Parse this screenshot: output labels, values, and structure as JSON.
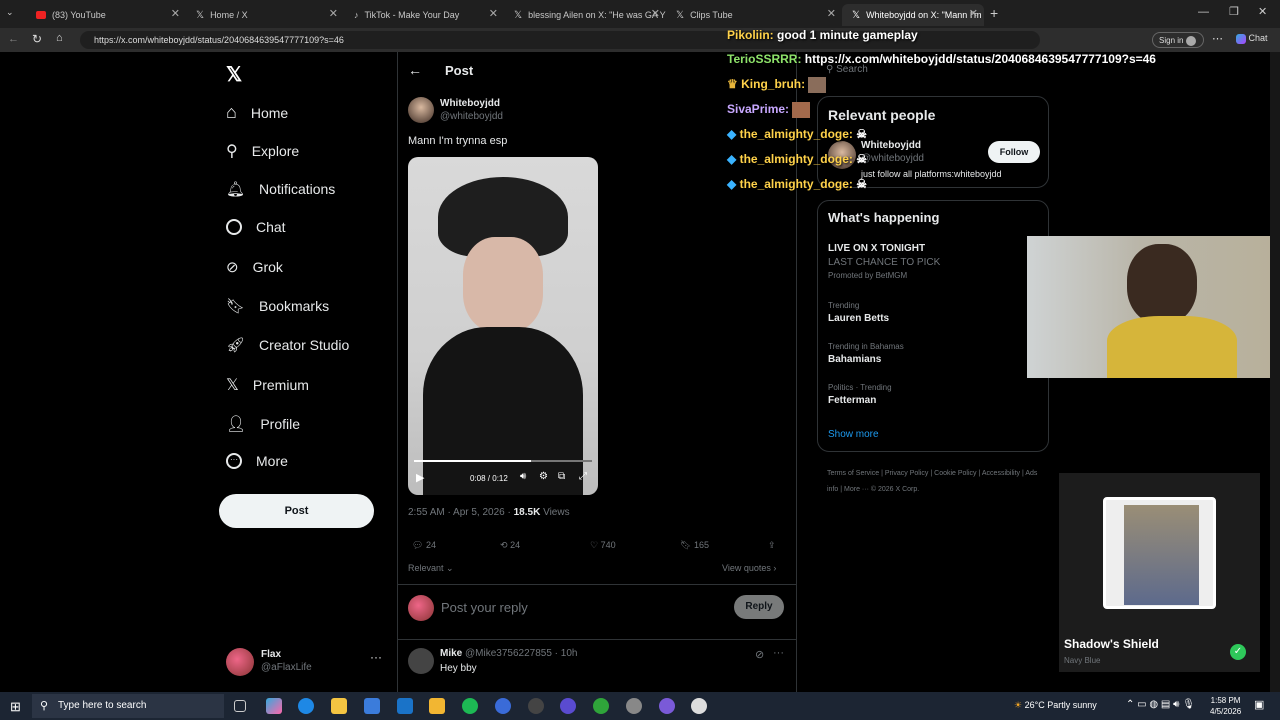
{
  "browser": {
    "tabs": [
      {
        "label": "(83) YouTube"
      },
      {
        "label": "Home / X"
      },
      {
        "label": "TikTok - Make Your Day"
      },
      {
        "label": "blessing Ailen on X: \"He was GA Y"
      },
      {
        "label": "Clips Tube"
      },
      {
        "label": "Whiteboyjdd on X: \"Mann I'm"
      }
    ],
    "url": "https://x.com/whiteboyjdd/status/2040684639547777109?s=46",
    "sign_in": "Sign in",
    "chat": "Chat"
  },
  "sidebar": {
    "items": [
      {
        "label": "Home"
      },
      {
        "label": "Explore"
      },
      {
        "label": "Notifications"
      },
      {
        "label": "Chat"
      },
      {
        "label": "Grok"
      },
      {
        "label": "Bookmarks"
      },
      {
        "label": "Creator Studio"
      },
      {
        "label": "Premium"
      },
      {
        "label": "Profile"
      },
      {
        "label": "More"
      }
    ],
    "post_button": "Post",
    "account": {
      "name": "Flax",
      "handle": "@aFlaxLife"
    }
  },
  "post": {
    "header": "Post",
    "author_name": "Whiteboyjdd",
    "author_handle": "@whiteboyjdd",
    "text": "Mann I'm trynna esp",
    "video_time": "0:08 / 0:12",
    "video_progress": 0.66,
    "timestamp": "2:55 AM · Apr 5, 2026 ·",
    "views_count": "18.5K",
    "views_label": "Views",
    "replies": "24",
    "reposts": "24",
    "likes": "740",
    "bookmarks": "165",
    "sort": "Relevant",
    "view_quotes": "View quotes",
    "reply_placeholder": "Post your reply",
    "reply_button": "Reply"
  },
  "reply": {
    "name": "Mike",
    "handle": "@Mike3756227855 · 10h",
    "text": "Hey bby"
  },
  "right": {
    "search_placeholder": "Search",
    "relevant_title": "Relevant people",
    "relevant_name": "Whiteboyjdd",
    "relevant_handle": "@whiteboyjdd",
    "relevant_bio": "just follow all platforms:whiteboyjdd",
    "follow": "Follow",
    "happening_title": "What's happening",
    "trends": [
      {
        "context": "",
        "title": "LIVE ON X TONIGHT",
        "sub": "LAST CHANCE TO PICK",
        "promo": "Promoted by BetMGM"
      },
      {
        "context": "Trending",
        "title": "Lauren Betts"
      },
      {
        "context": "Trending in Bahamas",
        "title": "Bahamians"
      },
      {
        "context": "Politics · Trending",
        "title": "Fetterman"
      }
    ],
    "show_more": "Show more",
    "footer": [
      "Terms of Service",
      "Privacy Policy",
      "Cookie Policy",
      "Accessibility",
      "Ads info",
      "More ···",
      "© 2026 X Corp."
    ]
  },
  "chat_overlay": [
    {
      "user": "Pikoliin:",
      "msg": "good 1 minute gameplay"
    },
    {
      "user": "TerioSSRRR:",
      "msg": "https://x.com/whiteboyjdd/status/2040684639547777109?s=46"
    },
    {
      "user": "King_bruh:",
      "msg": ""
    },
    {
      "user": "SivaPrime:",
      "msg": ""
    },
    {
      "user": "the_almighty_doge:",
      "msg": ""
    },
    {
      "user": "the_almighty_doge:",
      "msg": ""
    },
    {
      "user": "the_almighty_doge:",
      "msg": ""
    }
  ],
  "overlay_card": {
    "title": "Shadow's Shield",
    "subtitle": "Navy Blue"
  },
  "taskbar": {
    "search_placeholder": "Type here to search",
    "weather": "26°C  Partly sunny",
    "time": "1:58 PM",
    "date": "4/5/2026"
  }
}
